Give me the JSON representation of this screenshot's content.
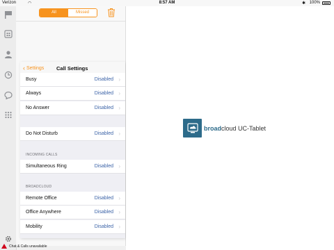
{
  "status_bar": {
    "carrier": "Verizon",
    "time": "8:57 AM",
    "battery": "100%"
  },
  "history": {
    "filter_all": "All",
    "filter_missed": "Missed"
  },
  "settings": {
    "back_label": "Settings",
    "title": "Call Settings",
    "rows_top": [
      {
        "label": "Busy",
        "value": "Disabled"
      },
      {
        "label": "Always",
        "value": "Disabled"
      },
      {
        "label": "No Answer",
        "value": "Disabled"
      }
    ],
    "dnd": {
      "label": "Do Not Disturb",
      "value": "Disabled"
    },
    "incoming_header": "INCOMING CALLS",
    "simring": {
      "label": "Simultaneous Ring",
      "value": "Disabled"
    },
    "broadcloud_header": "BROADCLOUD",
    "broadcloud_rows": [
      {
        "label": "Remote Office",
        "value": "Disabled"
      },
      {
        "label": "Office Anywhere",
        "value": "Disabled"
      },
      {
        "label": "Mobility",
        "value": "Disabled"
      }
    ]
  },
  "brand": {
    "name_bold": "broad",
    "name_rest": "cloud",
    "product": "UC-Tablet"
  },
  "footer": {
    "warning_text": "Chat & Calls unavailable"
  },
  "colors": {
    "accent": "#f7931e",
    "value_blue": "#3a62a7",
    "brand_blue": "#2d6b8a",
    "warning_red": "#d0021b"
  }
}
